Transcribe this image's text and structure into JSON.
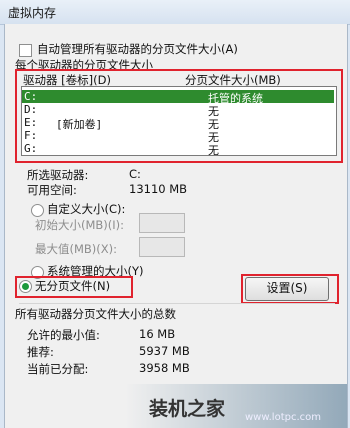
{
  "window": {
    "title": "虚拟内存"
  },
  "auto_manage": {
    "label": "自动管理所有驱动器的分页文件大小(A)",
    "checked": false
  },
  "drives_group": {
    "title": "每个驱动器的分页文件大小",
    "col_drive": "驱动器 [卷标](D)",
    "col_size": "分页文件大小(MB)",
    "rows": [
      {
        "drive": "C:",
        "label": "",
        "size": "托管的系统"
      },
      {
        "drive": "D:",
        "label": "",
        "size": "无"
      },
      {
        "drive": "E:",
        "label": "[新加卷]",
        "size": "无"
      },
      {
        "drive": "F:",
        "label": "",
        "size": "无"
      },
      {
        "drive": "G:",
        "label": "",
        "size": "无"
      }
    ]
  },
  "selected_drive": {
    "label": "所选驱动器:",
    "value": "C:"
  },
  "free_space": {
    "label": "可用空间:",
    "value": "13110 MB"
  },
  "custom_size": {
    "label": "自定义大小(C):"
  },
  "initial_size": {
    "label": "初始大小(MB)(I):"
  },
  "max_size": {
    "label": "最大值(MB)(X):"
  },
  "system_managed": {
    "label": "系统管理的大小(Y)"
  },
  "no_paging": {
    "label": "无分页文件(N)",
    "selected": true
  },
  "set_button": {
    "label": "设置(S)"
  },
  "totals": {
    "title": "所有驱动器分页文件大小的总数",
    "min_label": "允许的最小值:",
    "min_value": "16 MB",
    "recommended_label": "推荐:",
    "recommended_value": "5937 MB",
    "current_label": "当前已分配:",
    "current_value": "3958 MB"
  },
  "watermark": {
    "text": "装机之家",
    "url": "www.lotpc.com"
  }
}
